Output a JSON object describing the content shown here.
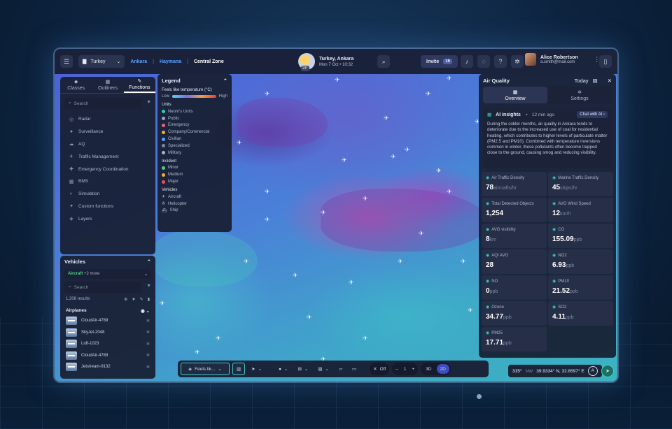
{
  "topbar": {
    "country": "Turkey",
    "breadcrumbs": [
      "Ankara",
      "Haymana",
      "Central Zone"
    ],
    "location_title": "Turkey, Ankara",
    "temp_badge": "23°",
    "datetime": "Mon 7 Oct  •  10:32",
    "invite_label": "Invite",
    "invite_count": "16",
    "user_name": "Alice Robertson",
    "user_email": "a.smith@mail.com"
  },
  "functions": {
    "tabs": [
      "Classes",
      "Outliners",
      "Functions"
    ],
    "search_placeholder": "Search",
    "items": [
      {
        "label": "Radar",
        "icon": "radar-icon"
      },
      {
        "label": "Surveillance",
        "icon": "location-pin-icon"
      },
      {
        "label": "AQ",
        "icon": "cloud-icon"
      },
      {
        "label": "Traffic Management",
        "icon": "plane-icon"
      },
      {
        "label": "Emergency Coordination",
        "icon": "emergency-icon"
      },
      {
        "label": "BMS",
        "icon": "building-icon"
      },
      {
        "label": "Simulation",
        "icon": "simulation-icon"
      },
      {
        "label": "Custom functions",
        "icon": "custom-icon"
      },
      {
        "label": "Layers",
        "icon": "layers-icon"
      }
    ]
  },
  "vehicles": {
    "title": "Vehicles",
    "filter_tag": "Aircraft",
    "filter_more": "+2 more",
    "search_placeholder": "Search",
    "results": "1,208 results",
    "group": "Airplanes",
    "rows": [
      "CloudAir-4789",
      "SkyJet-2048",
      "Luft-1023",
      "CloudAir-4789",
      "Jetstream-9132"
    ]
  },
  "legend": {
    "title": "Legend",
    "gradient_title": "Feels like temperature (°C)",
    "low": "Low",
    "high": "High",
    "units_title": "Units",
    "units": [
      {
        "label": "Neom's Units",
        "color": "#2fd1c0"
      },
      {
        "label": "Public",
        "color": "#9aa6bc"
      },
      {
        "label": "Emergency",
        "color": "#f06080"
      },
      {
        "label": "Company/Commercial",
        "color": "#f0b030"
      },
      {
        "label": "Civilian",
        "color": "#5aa0ff"
      },
      {
        "label": "Specialized",
        "color": "#7d89a2"
      },
      {
        "label": "Military",
        "color": "#aab4c8"
      }
    ],
    "incident_title": "Incident",
    "incidents": [
      {
        "label": "Minor",
        "color": "#4fd18b"
      },
      {
        "label": "Medium",
        "color": "#f0b030"
      },
      {
        "label": "Major",
        "color": "#f05050"
      }
    ],
    "vehicles_title": "Vehicles",
    "vehicle_types": [
      {
        "label": "Aircraft",
        "icon": "✈"
      },
      {
        "label": "Helicopter",
        "icon": "✇"
      },
      {
        "label": "Ship",
        "icon": "⛴"
      }
    ]
  },
  "air_quality": {
    "title": "Air Quality",
    "period": "Today",
    "tabs": [
      "Overview",
      "Settings"
    ],
    "insights_title": "AI insights",
    "insights_time": "12 min ago",
    "chat_label": "Chat with AI",
    "insights_text": "During the colder months, air quality in Ankara tends to deteriorate due to the increased use of coal for residential heating, which contributes to higher levels of particulate matter (PM2.5 and PM10). Combined with temperature inversions common in winter, these pollutants often become trapped close to the ground, causing smog and reducing visibility.",
    "metrics": [
      {
        "label": "Air Traffic Density",
        "value": "78",
        "unit": "aircrafts/hr"
      },
      {
        "label": "Marine Traffic Density",
        "value": "45",
        "unit": "ships/hr"
      },
      {
        "label": "Total Detected Objects",
        "value": "1,254",
        "unit": ""
      },
      {
        "label": "AVG Wind Speed",
        "value": "12",
        "unit": "km/h"
      },
      {
        "label": "AVG visibility",
        "value": "8",
        "unit": "km"
      },
      {
        "label": "CO",
        "value": "155.09",
        "unit": "ppb"
      },
      {
        "label": "AQI AVG",
        "value": "28",
        "unit": ""
      },
      {
        "label": "NO2",
        "value": "6.93",
        "unit": "ppb"
      },
      {
        "label": "NO",
        "value": "0",
        "unit": "ppb"
      },
      {
        "label": "PM10",
        "value": "21.52",
        "unit": "ppb"
      },
      {
        "label": "Ozone",
        "value": "34.77",
        "unit": "ppb"
      },
      {
        "label": "SO2",
        "value": "4.11",
        "unit": "ppb"
      },
      {
        "label": "PM25",
        "value": "17.71",
        "unit": "ppb"
      }
    ]
  },
  "toolbar": {
    "layer_label": "Feels lik...",
    "toggle_label": "Off",
    "zoom_value": "1",
    "view_3d": "3D",
    "view_2d": "2D"
  },
  "coords": {
    "heading": "315°",
    "heading_dir": "NW",
    "position": "39.9334° N, 32.8597° E"
  }
}
